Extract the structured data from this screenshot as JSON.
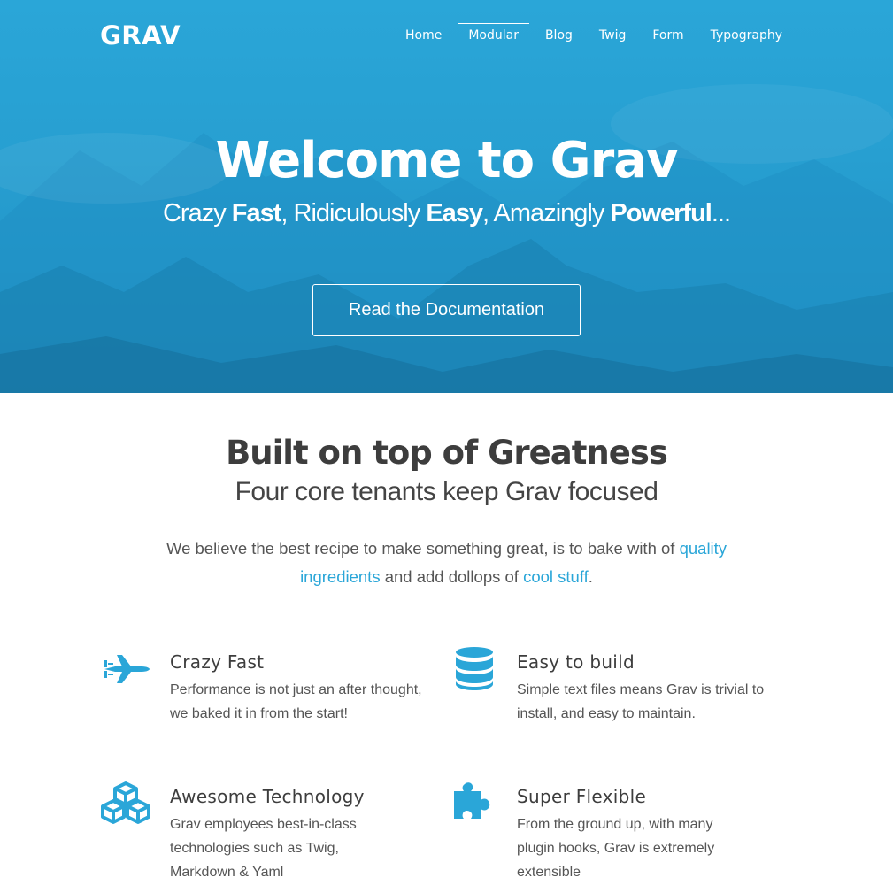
{
  "nav": {
    "logo": "GRAV",
    "items": [
      {
        "label": "Home",
        "active": false
      },
      {
        "label": "Modular",
        "active": true
      },
      {
        "label": "Blog",
        "active": false
      },
      {
        "label": "Twig",
        "active": false
      },
      {
        "label": "Form",
        "active": false
      },
      {
        "label": "Typography",
        "active": false
      }
    ]
  },
  "hero": {
    "title": "Welcome to Grav",
    "subtitle": {
      "p1": "Crazy ",
      "b1": "Fast",
      "p2": ", Ridiculously ",
      "b2": "Easy",
      "p3": ", Amazingly ",
      "b3": "Powerful",
      "p4": "..."
    },
    "button_label": "Read the Documentation"
  },
  "section": {
    "title": "Built on top of Greatness",
    "subtitle": "Four core tenants keep Grav focused",
    "intro": {
      "t1": "We believe the best recipe to make something great, is to bake with of ",
      "link1": "quality ingredients",
      "t2": " and add dollops of ",
      "link2": "cool stuff",
      "t3": "."
    }
  },
  "features": [
    {
      "icon": "fighter-jet-icon",
      "title": "Crazy Fast",
      "text": "Performance is not just an after thought, we baked it in from the start!"
    },
    {
      "icon": "database-icon",
      "title": "Easy to build",
      "text": "Simple text files means Grav is trivial to install, and easy to maintain."
    },
    {
      "icon": "cubes-icon",
      "title": "Awesome Technology",
      "text": "Grav employees best-in-class technologies such as Twig, Markdown & Yaml"
    },
    {
      "icon": "puzzle-piece-icon",
      "title": "Super Flexible",
      "text": "From the ground up, with many plugin hooks, Grav is extremely extensible"
    }
  ],
  "colors": {
    "accent": "#2aa6d8",
    "hero_bg": "#279fd1",
    "heading": "#3d3d3d",
    "body_text": "#555555"
  }
}
